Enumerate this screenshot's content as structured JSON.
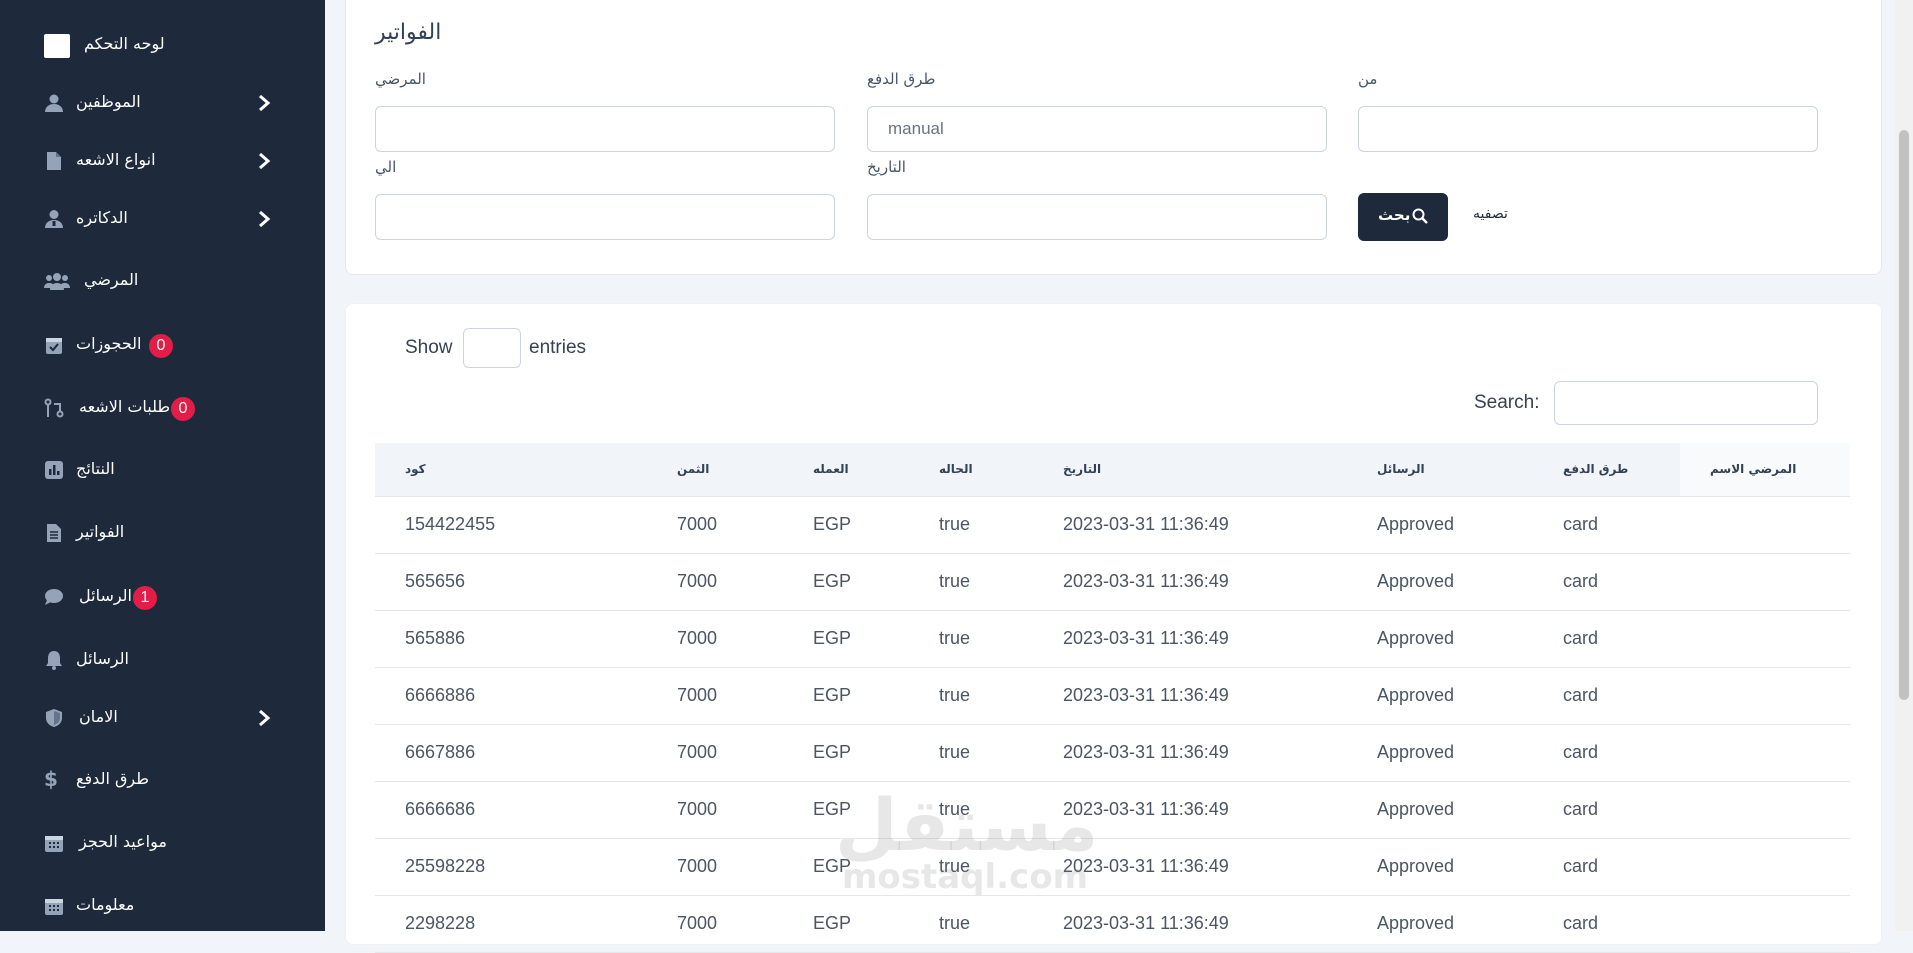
{
  "sidebar": {
    "items": [
      {
        "label": "لوحه التحكم",
        "icon": "dashboard-icon"
      },
      {
        "label": "الموظفين",
        "icon": "user-icon"
      },
      {
        "label": "انواع الاشعه",
        "icon": "file-icon"
      },
      {
        "label": "الدكاتره",
        "icon": "doctor-icon"
      },
      {
        "label": "المرضي",
        "icon": "users-icon"
      },
      {
        "label": "الحجوزات",
        "icon": "calendar-check-icon",
        "badge": "0"
      },
      {
        "label": "طلبات الاشعه",
        "icon": "code-pull-icon",
        "badge": "0"
      },
      {
        "label": "النتائج",
        "icon": "chart-icon"
      },
      {
        "label": "الفواتير",
        "icon": "invoice-icon"
      },
      {
        "label": "الرسائل",
        "icon": "comment-icon",
        "badge": "1"
      },
      {
        "label": "الرسائل",
        "icon": "bell-icon"
      },
      {
        "label": "الامان",
        "icon": "shield-icon"
      },
      {
        "label": "طرق الدفع",
        "icon": "dollar-icon"
      },
      {
        "label": "مواعيد الحجز",
        "icon": "calendar-icon"
      },
      {
        "label": "معلومات",
        "icon": "calendar-icon"
      }
    ]
  },
  "filter": {
    "title": "الفواتير",
    "patient_label": "المرضي",
    "payment_label": "طرق الدفع",
    "payment_value": "manual",
    "from_label": "من",
    "to_label": "الي",
    "date_label": "التاريخ",
    "search_button": "بحث",
    "clear_link": "تصفيه"
  },
  "table": {
    "show_label": "Show",
    "entries_label": "entries",
    "search_label": "Search:",
    "headers": [
      "كود",
      "الثمن",
      "العمله",
      "الحاله",
      "التاريخ",
      "الرسائل",
      "طرق الدفع",
      "المرضي الاسم"
    ],
    "rows": [
      [
        "154422455",
        "7000",
        "EGP",
        "true",
        "2023-03-31 11:36:49",
        "Approved",
        "card",
        ""
      ],
      [
        "565656",
        "7000",
        "EGP",
        "true",
        "2023-03-31 11:36:49",
        "Approved",
        "card",
        ""
      ],
      [
        "565886",
        "7000",
        "EGP",
        "true",
        "2023-03-31 11:36:49",
        "Approved",
        "card",
        ""
      ],
      [
        "6666886",
        "7000",
        "EGP",
        "true",
        "2023-03-31 11:36:49",
        "Approved",
        "card",
        ""
      ],
      [
        "6667886",
        "7000",
        "EGP",
        "true",
        "2023-03-31 11:36:49",
        "Approved",
        "card",
        ""
      ],
      [
        "6666686",
        "7000",
        "EGP",
        "true",
        "2023-03-31 11:36:49",
        "Approved",
        "card",
        ""
      ],
      [
        "25598228",
        "7000",
        "EGP",
        "true",
        "2023-03-31 11:36:49",
        "Approved",
        "card",
        ""
      ],
      [
        "2298228",
        "7000",
        "EGP",
        "true",
        "2023-03-31 11:36:49",
        "Approved",
        "card",
        ""
      ]
    ]
  },
  "watermark": {
    "arabic": "مستقل",
    "latin": "mostaql.com"
  },
  "colors": {
    "sidebar": "#1e293b",
    "badge": "#e11d48",
    "page_bg": "#f1f5f9"
  }
}
